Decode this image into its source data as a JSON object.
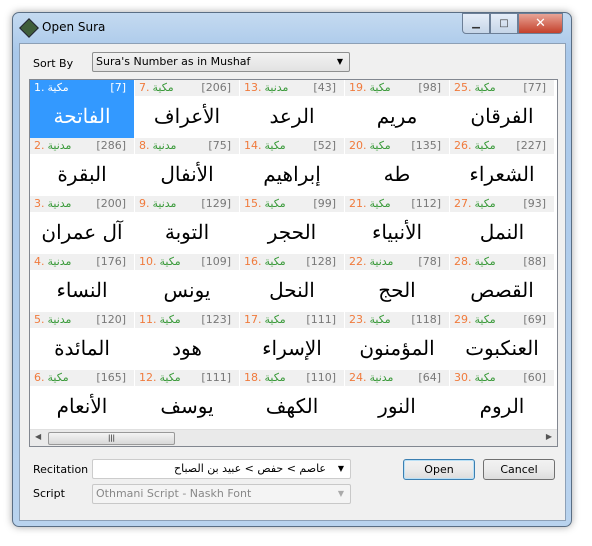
{
  "window": {
    "title": "Open Sura"
  },
  "sort": {
    "label": "Sort By",
    "value": "Sura's Number as in Mushaf"
  },
  "suras": [
    [
      "1",
      "مكية",
      "7",
      "الفاتحة"
    ],
    [
      "2",
      "مدنية",
      "286",
      "البقرة"
    ],
    [
      "3",
      "مدنية",
      "200",
      "آل عمران"
    ],
    [
      "4",
      "مدنية",
      "176",
      "النساء"
    ],
    [
      "5",
      "مدنية",
      "120",
      "المائدة"
    ],
    [
      "6",
      "مكية",
      "165",
      "الأنعام"
    ],
    [
      "7",
      "مكية",
      "206",
      "الأعراف"
    ],
    [
      "8",
      "مدنية",
      "75",
      "الأنفال"
    ],
    [
      "9",
      "مدنية",
      "129",
      "التوبة"
    ],
    [
      "10",
      "مكية",
      "109",
      "يونس"
    ],
    [
      "11",
      "مكية",
      "123",
      "هود"
    ],
    [
      "12",
      "مكية",
      "111",
      "يوسف"
    ],
    [
      "13",
      "مدنية",
      "43",
      "الرعد"
    ],
    [
      "14",
      "مكية",
      "52",
      "إبراهيم"
    ],
    [
      "15",
      "مكية",
      "99",
      "الحجر"
    ],
    [
      "16",
      "مكية",
      "128",
      "النحل"
    ],
    [
      "17",
      "مكية",
      "111",
      "الإسراء"
    ],
    [
      "18",
      "مكية",
      "110",
      "الكهف"
    ],
    [
      "19",
      "مكية",
      "98",
      "مريم"
    ],
    [
      "20",
      "مكية",
      "135",
      "طه"
    ],
    [
      "21",
      "مكية",
      "112",
      "الأنبياء"
    ],
    [
      "22",
      "مدنية",
      "78",
      "الحج"
    ],
    [
      "23",
      "مكية",
      "118",
      "المؤمنون"
    ],
    [
      "24",
      "مدنية",
      "64",
      "النور"
    ],
    [
      "25",
      "مكية",
      "77",
      "الفرقان"
    ],
    [
      "26",
      "مكية",
      "227",
      "الشعراء"
    ],
    [
      "27",
      "مكية",
      "93",
      "النمل"
    ],
    [
      "28",
      "مكية",
      "88",
      "القصص"
    ],
    [
      "29",
      "مكية",
      "69",
      "العنكبوت"
    ],
    [
      "30",
      "مكية",
      "60",
      "الروم"
    ]
  ],
  "selected": "1",
  "recitation": {
    "label": "Recitation",
    "value": "عاصم > حفص > عبيد بن الصباح"
  },
  "script": {
    "label": "Script",
    "value": "Othmani Script - Naskh Font"
  },
  "buttons": {
    "open": "Open",
    "cancel": "Cancel"
  },
  "colors": {
    "number": "#f07a3c",
    "type": "#3a9a3a",
    "selection": "#3399ff"
  }
}
